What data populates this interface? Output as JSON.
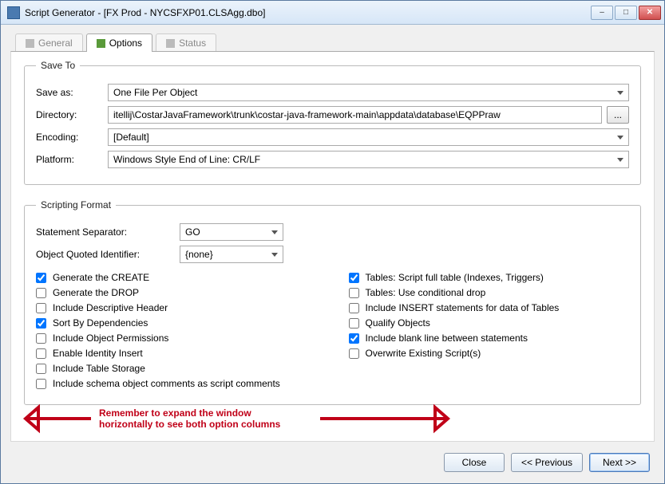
{
  "window": {
    "title": "Script Generator - [FX Prod - NYCSFXP01.CLSAgg.dbo]"
  },
  "tabs": {
    "general": "General",
    "options": "Options",
    "status": "Status"
  },
  "saveTo": {
    "legend": "Save To",
    "saveAsLabel": "Save as:",
    "saveAsValue": "One File Per Object",
    "directoryLabel": "Directory:",
    "directoryValue": "itellij\\CostarJavaFramework\\trunk\\costar-java-framework-main\\appdata\\database\\EQPPraw",
    "browse": "...",
    "encodingLabel": "Encoding:",
    "encodingValue": "[Default]",
    "platformLabel": "Platform:",
    "platformValue": "Windows Style End of Line: CR/LF"
  },
  "scriptingFormat": {
    "legend": "Scripting Format",
    "stmtSepLabel": "Statement Separator:",
    "stmtSepValue": "GO",
    "objQuotedLabel": "Object Quoted Identifier:",
    "objQuotedValue": "{none}",
    "left": {
      "generateCreate": "Generate the CREATE",
      "generateDrop": "Generate the DROP",
      "includeDescHeader": "Include Descriptive Header",
      "sortByDeps": "Sort By Dependencies",
      "includeObjPerms": "Include Object Permissions",
      "enableIdentityInsert": "Enable Identity Insert",
      "includeTableStorage": "Include Table Storage",
      "includeSchemaComments": "Include schema object comments as script comments"
    },
    "right": {
      "tablesFull": "Tables: Script full table (Indexes, Triggers)",
      "tablesCondDrop": "Tables: Use conditional drop",
      "includeInsertStmts": "Include INSERT statements for data of Tables",
      "qualifyObjects": "Qualify Objects",
      "includeBlankLine": "Include blank line between statements",
      "overwriteExisting": "Overwrite Existing Script(s)"
    }
  },
  "annotation": {
    "line1": "Remember to expand the window",
    "line2": "horizontally to see both option columns"
  },
  "buttons": {
    "close": "Close",
    "previous": "<< Previous",
    "next": "Next >>"
  }
}
